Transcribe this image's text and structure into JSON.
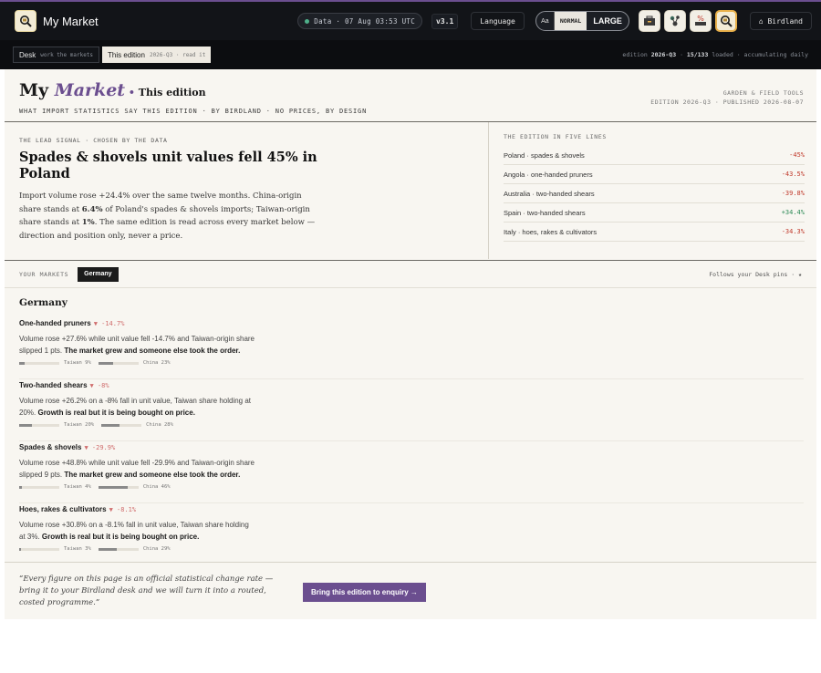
{
  "app": {
    "name": "My Market"
  },
  "topbar": {
    "data_status": "Data · 07 Aug 03:53 UTC",
    "version": "v3.1",
    "language_label": "Language",
    "size_aa": "Aa",
    "size_normal": "NORMAL",
    "size_large": "LARGE",
    "user_label": "⌂ Birdland"
  },
  "subbar": {
    "desk_label": "Desk",
    "desk_sub": "work the markets",
    "edition_label": "This edition",
    "edition_sub": "2026-Q3 · read it",
    "edition_pre": "edition",
    "edition_code": "2026-Q3",
    "loaded_count": "15/133",
    "loaded_label": "loaded",
    "loaded_note": "· accumulating daily"
  },
  "header": {
    "title_my": "My",
    "title_market": "Market",
    "title_sep": " • ",
    "title_edition": "This edition",
    "tagline": "WHAT IMPORT STATISTICS SAY THIS EDITION · BY BIRDLAND · NO PRICES, BY DESIGN",
    "pub_line1": "GARDEN & FIELD TOOLS",
    "pub_line2": "EDITION 2026-Q3 · PUBLISHED 2026-08-07"
  },
  "lead": {
    "label": "THE LEAD SIGNAL · CHOSEN BY THE DATA",
    "headline": "Spades & shovels unit values fell 45% in Poland",
    "body_a": "Import volume rose +24.4% over the same twelve months. China-origin share stands at ",
    "body_b": "6.4%",
    "body_c": " of Poland's spades & shovels imports; Taiwan-origin share stands at ",
    "body_d": "1%",
    "body_e": ". The same edition is read across every market below — direction and position only, never a price."
  },
  "five_lines": {
    "label": "THE EDITION IN FIVE LINES",
    "rows": [
      {
        "label": "Poland · spades & shovels",
        "value": "-45%",
        "dir": "neg"
      },
      {
        "label": "Angola · one-handed pruners",
        "value": "-43.5%",
        "dir": "neg"
      },
      {
        "label": "Australia · two-handed shears",
        "value": "-39.8%",
        "dir": "neg"
      },
      {
        "label": "Spain · two-handed shears",
        "value": "+34.4%",
        "dir": "pos"
      },
      {
        "label": "Italy · hoes, rakes & cultivators",
        "value": "-34.3%",
        "dir": "neg"
      }
    ]
  },
  "markets": {
    "label": "YOUR MARKETS",
    "chip": "Germany",
    "follows": "Follows your Desk pins · ★",
    "country": "Germany",
    "items": [
      {
        "name": "One-handed pruners",
        "change": "▼ -14.7%",
        "desc": "Volume rose +27.6% while unit value fell -14.7% and Taiwan-origin share slipped 1 pts. ",
        "desc_bold": "The market grew and someone else took the order.",
        "taiwan_label": "Taiwan 9%",
        "taiwan": 9,
        "china_label": "China 23%",
        "china": 23
      },
      {
        "name": "Two-handed shears",
        "change": "▼ -8%",
        "desc": "Volume rose +26.2% on a -8% fall in unit value, Taiwan share holding at 20%. ",
        "desc_bold": "Growth is real but it is being bought on price.",
        "taiwan_label": "Taiwan 20%",
        "taiwan": 20,
        "china_label": "China 28%",
        "china": 28
      },
      {
        "name": "Spades & shovels",
        "change": "▼ -29.9%",
        "desc": "Volume rose +48.8% while unit value fell -29.9% and Taiwan-origin share slipped 9 pts. ",
        "desc_bold": "The market grew and someone else took the order.",
        "taiwan_label": "Taiwan 4%",
        "taiwan": 4,
        "china_label": "China 46%",
        "china": 46
      },
      {
        "name": "Hoes, rakes & cultivators",
        "change": "▼ -8.1%",
        "desc": "Volume rose +30.8% on a -8.1% fall in unit value, Taiwan share holding at 3%. ",
        "desc_bold": "Growth is real but it is being bought on price.",
        "taiwan_label": "Taiwan 3%",
        "taiwan": 3,
        "china_label": "China 29%",
        "china": 29
      }
    ]
  },
  "footer": {
    "quote": "“Every figure on this page is an official statistical change rate — bring it to your Birdland desk and we will turn it into a routed, costed programme.”",
    "cta": "Bring this edition to enquiry →"
  },
  "colors": {
    "accent": "#6b4e8f",
    "negative": "#c0392b",
    "positive": "#2e8b57"
  }
}
